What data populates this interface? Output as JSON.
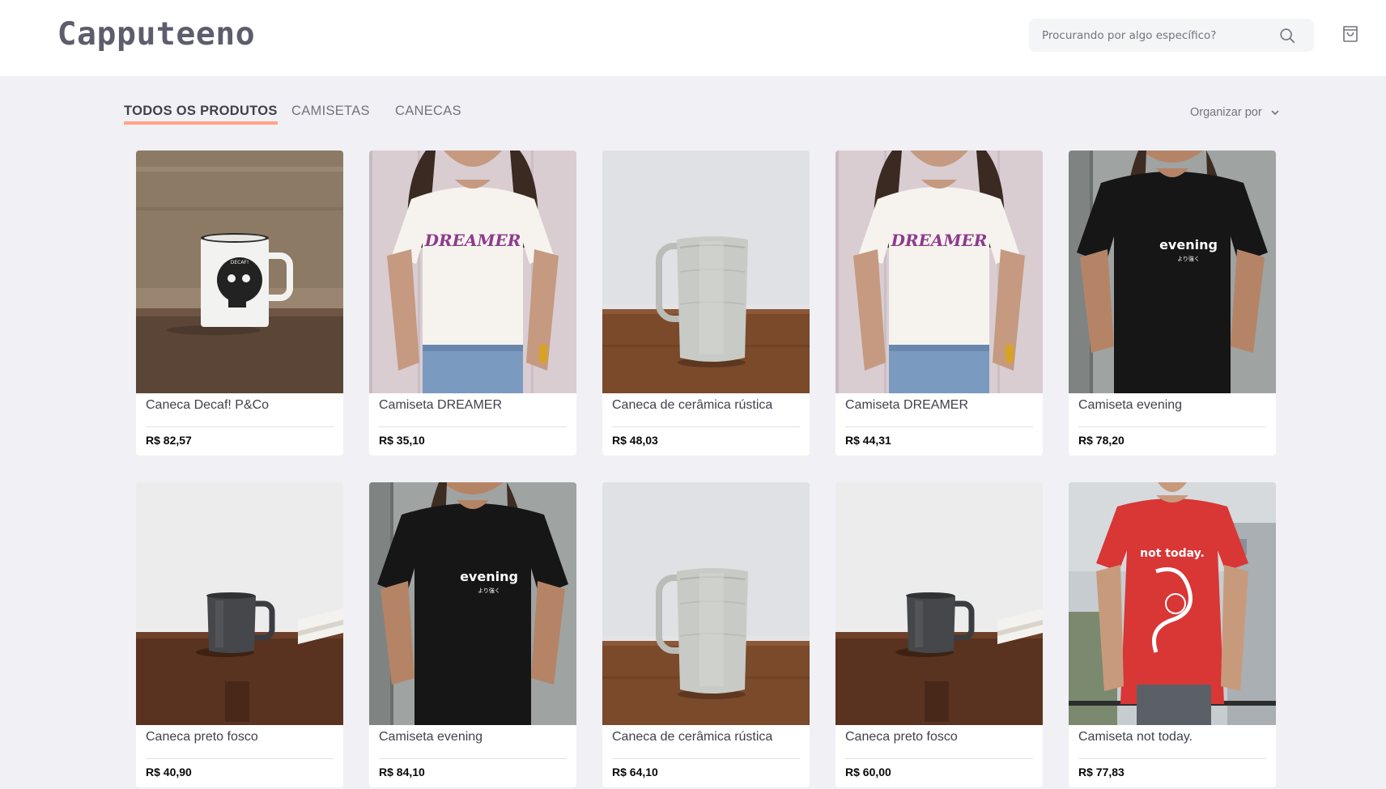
{
  "header": {
    "logo": "Capputeeno",
    "search_placeholder": "Procurando por algo específico?"
  },
  "tabs": [
    {
      "label": "TODOS OS PRODUTOS",
      "active": true
    },
    {
      "label": "CAMISETAS",
      "active": false
    },
    {
      "label": "CANECAS",
      "active": false
    }
  ],
  "sort": {
    "label": "Organizar por"
  },
  "products": [
    {
      "name": "Caneca Decaf! P&Co",
      "price": "R$ 82,57",
      "image": "white-mug-skull"
    },
    {
      "name": "Camiseta DREAMER",
      "price": "R$ 35,10",
      "image": "white-tshirt-dreamer"
    },
    {
      "name": "Caneca de cerâmica rústica",
      "price": "R$ 48,03",
      "image": "ceramic-mug"
    },
    {
      "name": "Camiseta DREAMER",
      "price": "R$ 44,31",
      "image": "white-tshirt-dreamer"
    },
    {
      "name": "Camiseta evening",
      "price": "R$ 78,20",
      "image": "black-tshirt-evening"
    },
    {
      "name": "Caneca preto fosco",
      "price": "R$ 40,90",
      "image": "black-mug"
    },
    {
      "name": "Camiseta evening",
      "price": "R$ 84,10",
      "image": "black-tshirt-evening"
    },
    {
      "name": "Caneca de cerâmica rústica",
      "price": "R$ 64,10",
      "image": "ceramic-mug"
    },
    {
      "name": "Caneca preto fosco",
      "price": "R$ 60,00",
      "image": "black-mug"
    },
    {
      "name": "Camiseta not today.",
      "price": "R$ 77,83",
      "image": "red-tshirt-not-today"
    }
  ],
  "image_text": {
    "dreamer": "DREAMER",
    "evening": "evening",
    "evening_sub": "より強く",
    "not_today": "not today.",
    "decaf": "DECAF!"
  },
  "colors": {
    "accent": "#ffa585",
    "text_dark": "#41414d",
    "text_muted": "#737380",
    "background": "#f0f0f5"
  }
}
